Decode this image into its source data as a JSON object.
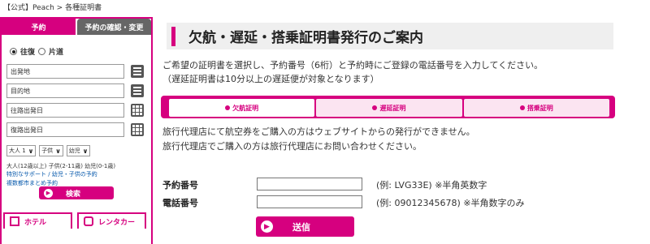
{
  "breadcrumb": "【公式】Peach > 各種証明書",
  "sidebar": {
    "tab_booking": "予約",
    "tab_manage": "予約の確認・変更",
    "trip_roundtrip": "往復",
    "trip_oneway": "片道",
    "field_origin": "出発地",
    "field_destination": "目的地",
    "field_depart_date": "往路出発日",
    "field_return_date": "復路出発日",
    "pax_adult": "大人 1",
    "pax_child": "子供",
    "pax_infant": "幼児",
    "pax_note": "大人(12歳以上) 子供(2-11歳) 幼児(0-1歳)",
    "link_support": "特別なサポート / 幼児・子供の予約",
    "link_multicity": "複数都市まとめ予約",
    "search_label": "検索",
    "tile_hotel": "ホテル",
    "tile_car": "レンタカー"
  },
  "main": {
    "title": "欠航・遅延・搭乗証明書発行のご案内",
    "intro_line1": "ご希望の証明書を選択し、予約番号（6桁）と予約時にご登録の電話番号を入力してください。",
    "intro_line2": "（遅延証明書は10分以上の遅延便が対象となります）",
    "cert_tabs": [
      "欠航証明",
      "遅延証明",
      "搭乗証明"
    ],
    "notice_line1": "旅行代理店にて航空券をご購入の方はウェブサイトからの発行ができません。",
    "notice_line2": "旅行代理店でご購入の方は旅行代理店にお問い合わせください。",
    "label_booking_no": "予約番号",
    "label_phone": "電話番号",
    "hint_booking_no": "(例: LVG33E) ※半角英数字",
    "hint_phone": "(例: 09012345678) ※半角数字のみ",
    "submit_label": "送信"
  },
  "colors": {
    "accent": "#d6007f",
    "tab_inactive": "#666666",
    "title_bg": "#efefef",
    "link": "#0055aa"
  },
  "icons": [
    "list-icon",
    "calendar-icon",
    "arrow-circle-icon",
    "hotel-icon",
    "car-icon"
  ]
}
